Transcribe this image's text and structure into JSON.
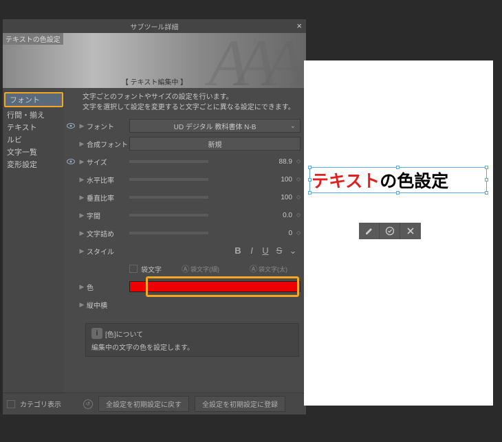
{
  "window": {
    "title": "サブツール詳細"
  },
  "header": {
    "title": "テキストの色設定",
    "editing": "【 テキスト編集中 】"
  },
  "sidebar": {
    "items": [
      {
        "label": "フォント",
        "selected": true
      },
      {
        "label": "行間・揃え"
      },
      {
        "label": "テキスト"
      },
      {
        "label": "ルビ"
      },
      {
        "label": "文字一覧"
      },
      {
        "label": "変形設定"
      }
    ]
  },
  "desc": {
    "l1": "文字ごとのフォントやサイズの設定を行います。",
    "l2": "文字を選択して設定を変更すると文字ごとに異なる設定にできます。"
  },
  "props": {
    "font": {
      "label": "フォント",
      "value": "UD デジタル 教科書体 N-B"
    },
    "compFont": {
      "label": "合成フォント",
      "btn": "新規"
    },
    "size": {
      "label": "サイズ",
      "value": "88.9"
    },
    "hratio": {
      "label": "水平比率",
      "value": "100"
    },
    "vratio": {
      "label": "垂直比率",
      "value": "100"
    },
    "tracking": {
      "label": "字間",
      "value": "0.0"
    },
    "kerning": {
      "label": "文字詰め",
      "value": "0"
    },
    "style": {
      "label": "スタイル"
    },
    "outline": {
      "chk": "袋文字",
      "thin": "袋文字(細)",
      "thick": "袋文字(太)"
    },
    "color": {
      "label": "色"
    },
    "tatechuyoko": {
      "label": "縦中横"
    }
  },
  "info": {
    "head": "[色]について",
    "body": "編集中の文字の色を設定します。"
  },
  "bottom": {
    "cat": "カテゴリ表示",
    "reset": "全設定を初期設定に戻す",
    "save": "全設定を初期設定に登録"
  },
  "canvas": {
    "text_red": "テキスト",
    "text_black": "の色設定"
  }
}
